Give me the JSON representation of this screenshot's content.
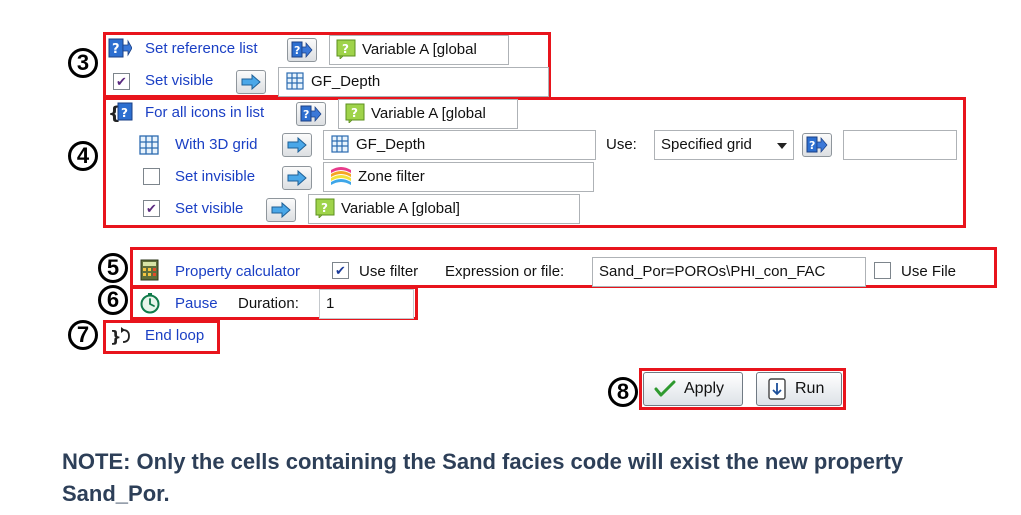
{
  "row3": {
    "ref_label": "Set reference list",
    "ref_value": "Variable A [global",
    "visible_label": "Set visible",
    "visible_value": "GF_Depth",
    "visible_checked": true
  },
  "row4": {
    "loop_label": "For all icons in list",
    "loop_value": "Variable A [global",
    "grid_label": "With 3D grid",
    "grid_value": "GF_Depth",
    "use_label": "Use:",
    "use_select": "Specified grid",
    "use_extra_value": "",
    "invisible_label": "Set invisible",
    "invisible_value": "Zone filter",
    "invisible_checked": false,
    "visible_label": "Set visible",
    "visible_value": "Variable A [global]",
    "visible_checked": true
  },
  "row5": {
    "calc_label": "Property calculator",
    "use_filter_label": "Use filter",
    "use_filter_checked": true,
    "expr_label": "Expression or file:",
    "expr_value": "Sand_Por=POROs\\PHI_con_FAC",
    "use_file_label": "Use File",
    "use_file_checked": false
  },
  "row6": {
    "pause_label": "Pause",
    "duration_label": "Duration:",
    "duration_value": "1"
  },
  "row7": {
    "end_loop_label": "End loop"
  },
  "buttons": {
    "apply_label": "Apply",
    "run_label": "Run"
  },
  "step_numbers": [
    "3",
    "4",
    "5",
    "6",
    "7",
    "8"
  ],
  "note": "NOTE: Only the cells containing the Sand facies code will exist the new property Sand_Por.",
  "colors": {
    "highlight_box": "#e8141c",
    "link_text": "#1a3fc4",
    "note_text": "#2d3f58"
  }
}
